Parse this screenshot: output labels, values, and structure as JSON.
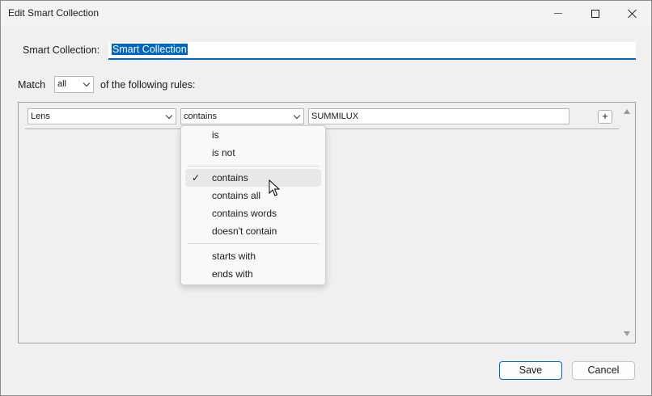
{
  "window": {
    "title": "Edit Smart Collection"
  },
  "collection": {
    "label": "Smart Collection:",
    "name_value": "Smart Collection"
  },
  "match": {
    "label": "Match",
    "selected": "all",
    "suffix": "of the following rules:"
  },
  "rule": {
    "field": "Lens",
    "operator": "contains",
    "value": "SUMMILUX",
    "add_label": "+"
  },
  "operator_menu": {
    "group1": [
      "is",
      "is not"
    ],
    "group2": [
      "contains",
      "contains all",
      "contains words",
      "doesn't contain"
    ],
    "group3": [
      "starts with",
      "ends with"
    ],
    "checked": "contains",
    "check_glyph": "✓"
  },
  "buttons": {
    "save": "Save",
    "cancel": "Cancel"
  },
  "colors": {
    "accent": "#0067c0",
    "window_bg": "#f0f0f0"
  }
}
